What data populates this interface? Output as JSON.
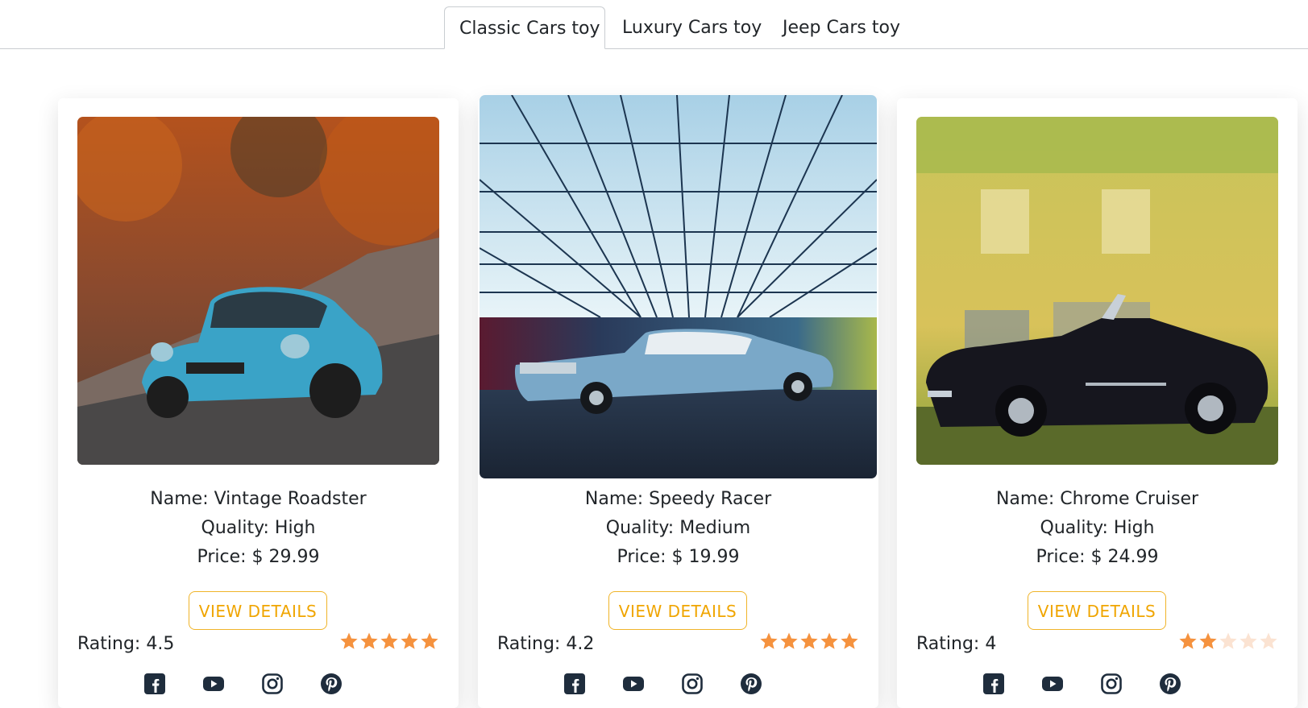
{
  "tabs": [
    {
      "label": "Classic Cars toy",
      "active": true
    },
    {
      "label": "Luxury Cars toy",
      "active": false
    },
    {
      "label": "Jeep Cars toy",
      "active": false
    }
  ],
  "products": [
    {
      "name": "Name: Vintage Roadster",
      "quality": "Quality: High",
      "price": "Price: $ 29.99",
      "button": "VIEW DETAILS",
      "rating": "Rating: 4.5",
      "stars_filled": 5,
      "image_alt": "Blue Alpine classic car on autumn road"
    },
    {
      "name": "Name: Speedy Racer",
      "quality": "Quality: Medium",
      "price": "Price: $ 19.99",
      "button": "VIEW DETAILS",
      "rating": "Rating: 4.2",
      "stars_filled": 5,
      "image_alt": "Blue convertible under light grid ceiling"
    },
    {
      "name": "Name: Chrome Cruiser",
      "quality": "Quality: High",
      "price": "Price: $ 24.99",
      "button": "VIEW DETAILS",
      "rating": "Rating: 4",
      "stars_filled": 2,
      "image_alt": "Black roadster toy car in front of yellow house"
    }
  ],
  "social_icons": [
    "facebook-icon",
    "youtube-icon",
    "instagram-icon",
    "pinterest-icon"
  ],
  "colors": {
    "accent": "#f0a500",
    "star_filled": "#f5923e",
    "star_empty": "#fbe3d2",
    "icon": "#1f2d3d"
  }
}
